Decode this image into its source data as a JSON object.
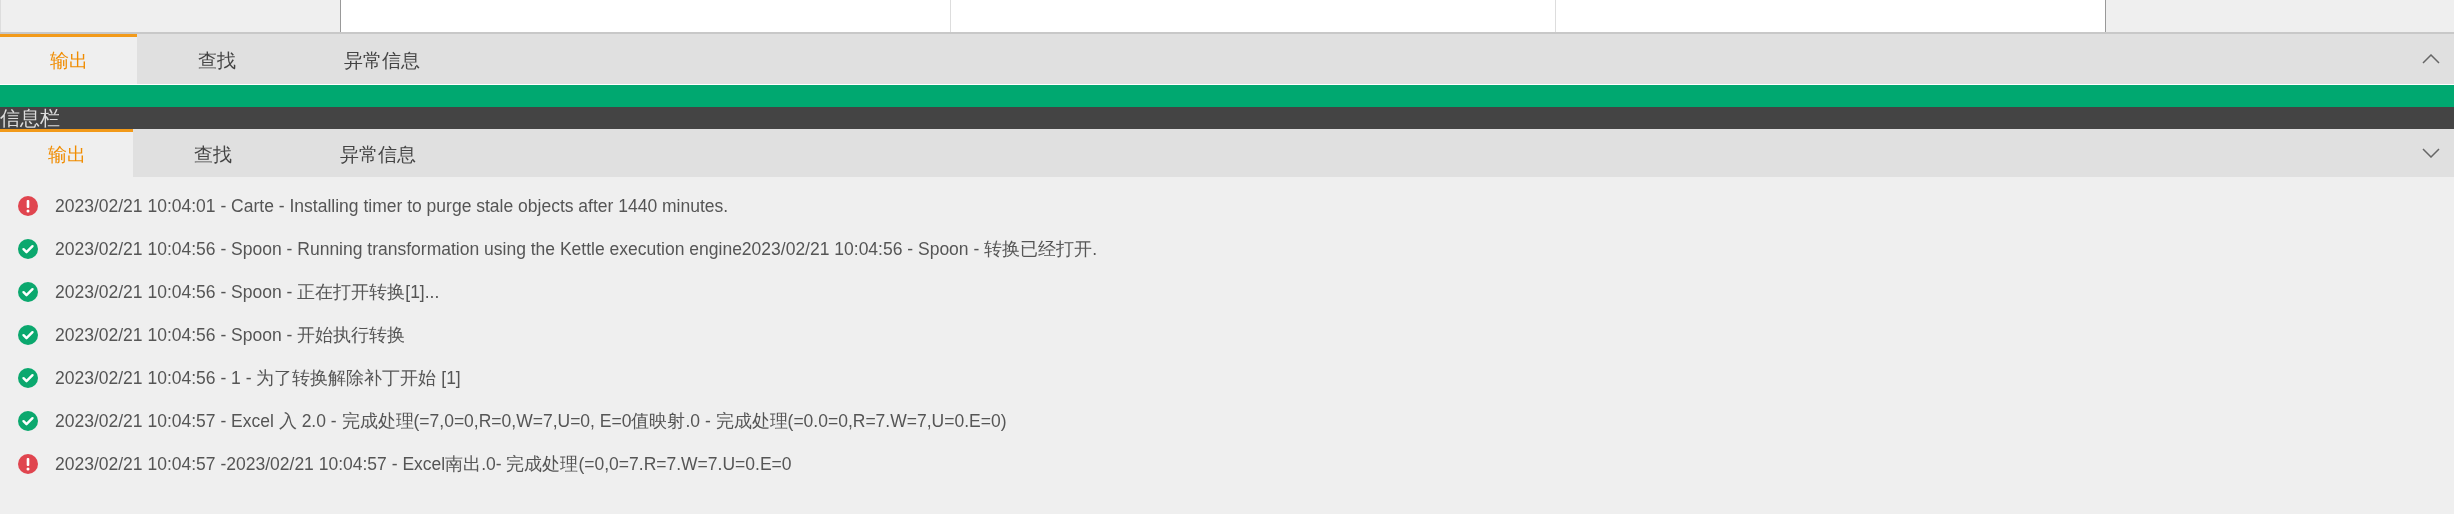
{
  "top_panel": {
    "expanded": false,
    "tabs": [
      {
        "label": "输出",
        "selected": true
      },
      {
        "label": "查找",
        "selected": false
      },
      {
        "label": "异常信息",
        "selected": false
      }
    ]
  },
  "info_bar": {
    "title": "信息栏"
  },
  "log_panel": {
    "expanded": true,
    "tabs": [
      {
        "label": "输出",
        "selected": true
      },
      {
        "label": "查找",
        "selected": false
      },
      {
        "label": "异常信息",
        "selected": false
      }
    ]
  },
  "log": [
    {
      "kind": "error",
      "text": "2023/02/21 10:04:01 - Carte - Installing timer to purge stale objects after 1440 minutes."
    },
    {
      "kind": "success",
      "text": "2023/02/21 10:04:56 - Spoon - Running transformation using the Kettle execution engine2023/02/21 10:04:56 - Spoon - 转换已经打开."
    },
    {
      "kind": "success",
      "text": "2023/02/21 10:04:56 - Spoon - 正在打开转换[1]..."
    },
    {
      "kind": "success",
      "text": "2023/02/21 10:04:56 - Spoon - 开始执行转换"
    },
    {
      "kind": "success",
      "text": "2023/02/21 10:04:56 - 1 - 为了转换解除补丁开始 [1]"
    },
    {
      "kind": "success",
      "text": "2023/02/21 10:04:57 - Excel 入 2.0 - 完成处理(=7,0=0,R=0,W=7,U=0, E=0值映射.0 - 完成处理(=0.0=0,R=7.W=7,U=0.E=0)"
    },
    {
      "kind": "error",
      "text": "2023/02/21 10:04:57 -2023/02/21 10:04:57 - Excel南出.0- 完成处理(=0,0=7.R=7.W=7.U=0.E=0"
    }
  ]
}
